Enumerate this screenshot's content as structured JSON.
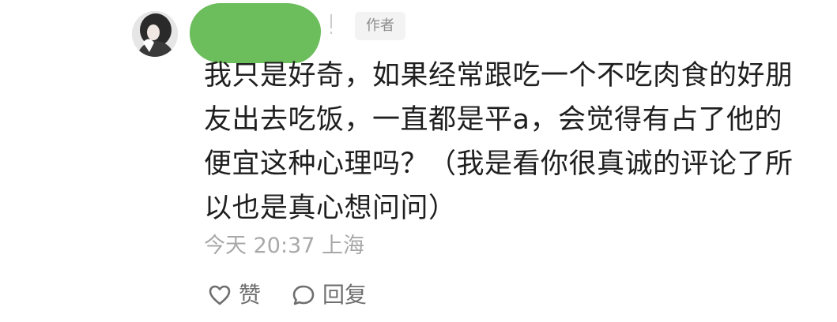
{
  "comment": {
    "author_tag": "作者",
    "text": "我只是好奇，如果经常跟吃一个不吃肉食的好朋友出去吃饭，一直都是平a，会觉得有占了他的便宜这种心理吗？（我是看你很真诚的评论了所以也是真心想问问）",
    "time": "今天 20:37",
    "location": "上海",
    "actions": {
      "like_label": "赞",
      "reply_label": "回复"
    }
  },
  "colors": {
    "redaction": "#6cbd5b",
    "text": "#1f1f1f",
    "meta": "#a8a8a8",
    "action": "#6f6f6f",
    "tag_bg": "#f3f3f3"
  },
  "icons": {
    "like": "heart-icon",
    "reply": "chat-bubble-icon"
  }
}
